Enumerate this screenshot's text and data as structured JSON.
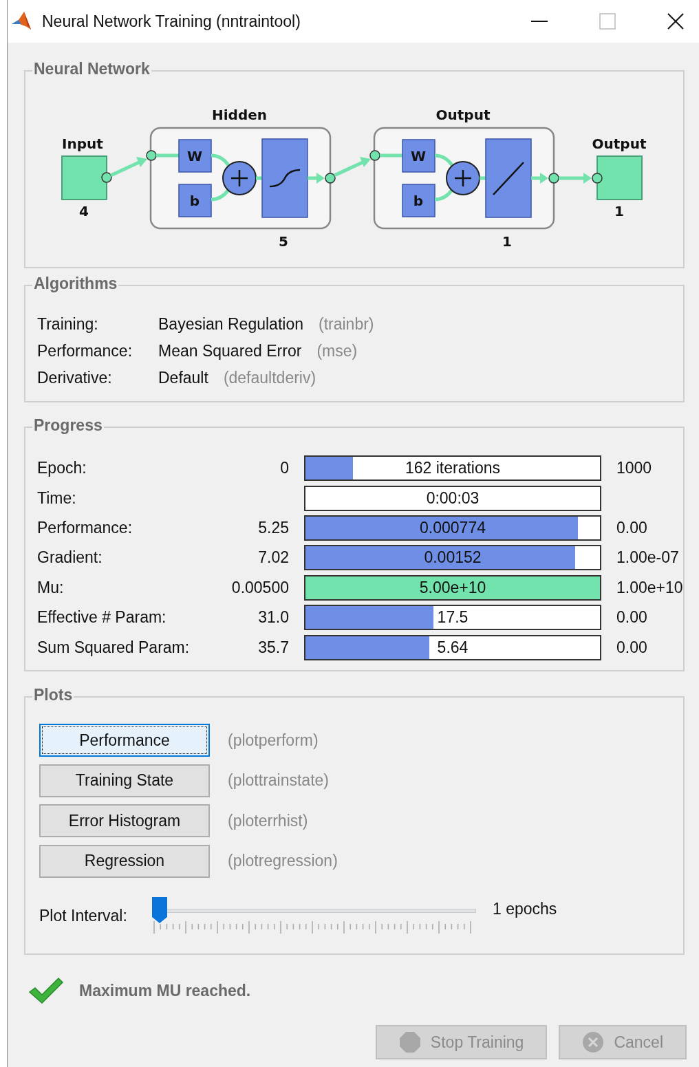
{
  "window": {
    "title": "Neural Network Training (nntraintool)"
  },
  "network": {
    "title": "Neural Network",
    "input": {
      "label": "Input",
      "size": "4"
    },
    "layers": [
      {
        "label": "Hidden",
        "weight": "W",
        "bias": "b",
        "kind": "tansig",
        "size": "5"
      },
      {
        "label": "Output",
        "weight": "W",
        "bias": "b",
        "kind": "purelin",
        "size": "1"
      }
    ],
    "output": {
      "label": "Output",
      "size": "1"
    }
  },
  "algorithms": {
    "title": "Algorithms",
    "rows": [
      {
        "label": "Training:",
        "value": "Bayesian Regulation",
        "code": "(trainbr)"
      },
      {
        "label": "Performance:",
        "value": "Mean Squared Error",
        "code": "(mse)"
      },
      {
        "label": "Derivative:",
        "value": "Default",
        "code": "(defaultderiv)"
      }
    ]
  },
  "progress": {
    "title": "Progress",
    "rows": [
      {
        "label": "Epoch:",
        "start": "0",
        "text": "162 iterations",
        "level": 0.162,
        "end": "1000",
        "color": "#6f8fe6"
      },
      {
        "label": "Time:",
        "text": "0:00:03"
      },
      {
        "label": "Performance:",
        "start": "5.25",
        "text": "0.000774",
        "level": 0.925,
        "end": "0.00",
        "color": "#6f8fe6"
      },
      {
        "label": "Gradient:",
        "start": "7.02",
        "text": "0.00152",
        "level": 0.915,
        "end": "1.00e-07",
        "color": "#6f8fe6"
      },
      {
        "label": "Mu:",
        "start": "0.00500",
        "text": "5.00e+10",
        "level": 1,
        "end": "1.00e+10",
        "color": "#73e3ad"
      },
      {
        "label": "Effective # Param:",
        "start": "31.0",
        "text": "17.5",
        "level": 0.435,
        "end": "0.00",
        "color": "#6f8fe6"
      },
      {
        "label": "Sum Squared Param:",
        "start": "35.7",
        "text": "5.64",
        "level": 0.42,
        "end": "0.00",
        "color": "#6f8fe6"
      }
    ]
  },
  "plots": {
    "title": "Plots",
    "buttons": [
      {
        "label": "Performance",
        "code": "(plotperform)",
        "focused": true
      },
      {
        "label": "Training State",
        "code": "(plottrainstate)",
        "focused": false
      },
      {
        "label": "Error Histogram",
        "code": "(ploterrhist)",
        "focused": false
      },
      {
        "label": "Regression",
        "code": "(plotregression)",
        "focused": false
      }
    ],
    "plot_interval": {
      "label": "Plot Interval:",
      "level": 0,
      "reading": "1 epochs"
    }
  },
  "status": {
    "ok": true,
    "message": "Maximum MU reached."
  },
  "buttons": [
    {
      "kind": "stop",
      "label": "Stop Training",
      "disabled": true
    },
    {
      "kind": "cancel",
      "label": "Cancel",
      "disabled": true
    }
  ]
}
